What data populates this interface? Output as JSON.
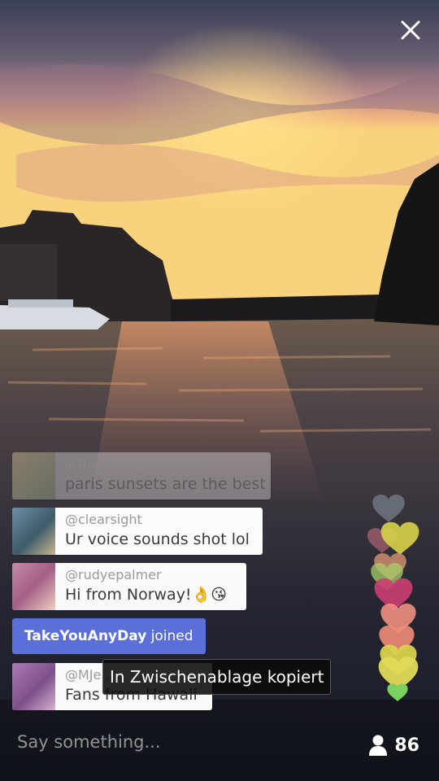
{
  "broadcast": {
    "close_icon": "close-icon",
    "viewer_icon": "person-icon",
    "viewer_count": "86"
  },
  "comments": [
    {
      "user": "@thedrunkgo...",
      "message": "paris sunsets are the best"
    },
    {
      "user": "@clearsight",
      "message": "Ur voice sounds shot lol"
    },
    {
      "user": "@rudyepalmer",
      "message": "Hi from Norway!👌😘"
    },
    {
      "user": "@MJe...",
      "message": "Fans from Hawaii"
    }
  ],
  "join_notice": {
    "name": "TakeYouAnyDay",
    "text": "joined"
  },
  "toast": {
    "text": "In Zwischenablage kopiert"
  },
  "composer": {
    "placeholder": "Say something..."
  }
}
